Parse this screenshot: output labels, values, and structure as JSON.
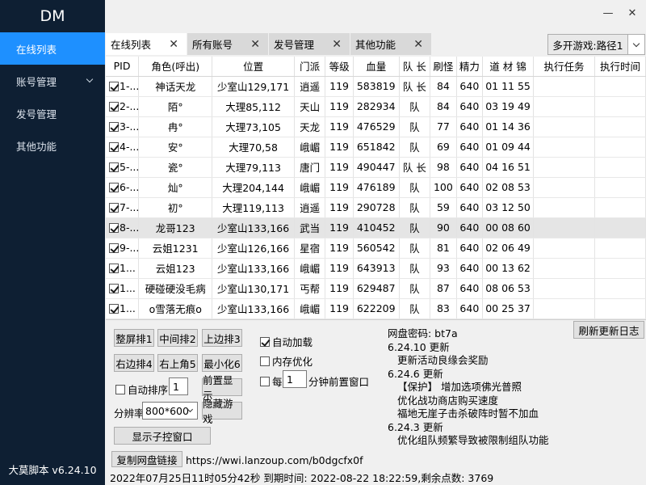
{
  "sidebar": {
    "title": "DM",
    "items": [
      {
        "label": "在线列表"
      },
      {
        "label": "账号管理"
      },
      {
        "label": "发号管理"
      },
      {
        "label": "其他功能"
      }
    ],
    "version": "大莫脚本 v6.24.10"
  },
  "window": {
    "minimize": "—",
    "close": "✕"
  },
  "tabs": [
    {
      "label": "在线列表"
    },
    {
      "label": "所有账号"
    },
    {
      "label": "发号管理"
    },
    {
      "label": "其他功能"
    }
  ],
  "route_button": "多开游戏:路径1",
  "table": {
    "headers": [
      "PID",
      "角色(呼出)",
      "位置",
      "门派",
      "等级",
      "血量",
      "队 长",
      "刷怪",
      "精力",
      "道 材 锦",
      "执行任务",
      "执行时间"
    ],
    "rows": [
      {
        "pid": "1-...",
        "role": "神话天龙",
        "pos": "少室山129,171",
        "sect": "逍遥",
        "lvl": "119",
        "hp": "583819",
        "team": "队 长",
        "kill": "84",
        "energy": "640",
        "items": "01 11 55",
        "task": "",
        "time": ""
      },
      {
        "pid": "2-...",
        "role": "陌°",
        "pos": "大理85,112",
        "sect": "天山",
        "lvl": "119",
        "hp": "282934",
        "team": "队",
        "kill": "84",
        "energy": "640",
        "items": "03 19 49",
        "task": "",
        "time": ""
      },
      {
        "pid": "3-...",
        "role": "冉°",
        "pos": "大理73,105",
        "sect": "天龙",
        "lvl": "119",
        "hp": "476529",
        "team": "队",
        "kill": "77",
        "energy": "640",
        "items": "01 14 36",
        "task": "",
        "time": ""
      },
      {
        "pid": "4-...",
        "role": "安°",
        "pos": "大理70,58",
        "sect": "峨嵋",
        "lvl": "119",
        "hp": "651842",
        "team": "队",
        "kill": "69",
        "energy": "640",
        "items": "01 09 44",
        "task": "",
        "time": ""
      },
      {
        "pid": "5-...",
        "role": "瓷°",
        "pos": "大理79,113",
        "sect": "唐门",
        "lvl": "119",
        "hp": "490447",
        "team": "队 长",
        "kill": "98",
        "energy": "640",
        "items": "04 16 51",
        "task": "",
        "time": ""
      },
      {
        "pid": "6-...",
        "role": "灿°",
        "pos": "大理204,144",
        "sect": "峨嵋",
        "lvl": "119",
        "hp": "476189",
        "team": "队",
        "kill": "100",
        "energy": "640",
        "items": "02 08 53",
        "task": "",
        "time": ""
      },
      {
        "pid": "7-...",
        "role": "初°",
        "pos": "大理119,113",
        "sect": "逍遥",
        "lvl": "119",
        "hp": "290728",
        "team": "队",
        "kill": "59",
        "energy": "640",
        "items": "03 12 50",
        "task": "",
        "time": ""
      },
      {
        "pid": "8-...",
        "role": "龙哥123",
        "pos": "少室山133,166",
        "sect": "武当",
        "lvl": "119",
        "hp": "410452",
        "team": "队",
        "kill": "90",
        "energy": "640",
        "items": "00 08 60",
        "task": "",
        "time": ""
      },
      {
        "pid": "9-...",
        "role": "云姐1231",
        "pos": "少室山126,166",
        "sect": "星宿",
        "lvl": "119",
        "hp": "560542",
        "team": "队",
        "kill": "81",
        "energy": "640",
        "items": "02 06 49",
        "task": "",
        "time": ""
      },
      {
        "pid": "1...",
        "role": "云姐123",
        "pos": "少室山133,166",
        "sect": "峨嵋",
        "lvl": "119",
        "hp": "643913",
        "team": "队",
        "kill": "93",
        "energy": "640",
        "items": "00 13 62",
        "task": "",
        "time": ""
      },
      {
        "pid": "1...",
        "role": "硬碰硬没毛病",
        "pos": "少室山130,171",
        "sect": "丐帮",
        "lvl": "119",
        "hp": "629487",
        "team": "队",
        "kill": "87",
        "energy": "640",
        "items": "08 06 53",
        "task": "",
        "time": ""
      },
      {
        "pid": "1...",
        "role": "o雪落无痕o",
        "pos": "少室山133,166",
        "sect": "峨嵋",
        "lvl": "119",
        "hp": "622209",
        "team": "队",
        "kill": "83",
        "energy": "640",
        "items": "00 25 37",
        "task": "",
        "time": ""
      }
    ]
  },
  "controls": {
    "fullscreen": "整屏排1",
    "middle": "中间排2",
    "top": "上边排3",
    "right": "右边排4",
    "topright": "右上角5",
    "minimize": "最小化6",
    "auto_sort": "自动排序",
    "auto_sort_value": "1",
    "front_show": "前置显示",
    "resolution_label": "分辨率",
    "resolution_value": "800*600",
    "hide_game": "隐藏游戏",
    "show_child": "显示子控窗口",
    "auto_load": "自动加载",
    "mem_opt": "内存优化",
    "every": "每",
    "every_value": "1",
    "every_suffix": "分钟前置窗口",
    "refresh_log": "刷新更新日志",
    "copy_link": "复制网盘链接"
  },
  "log": [
    {
      "text": "网盘密码:  bt7a",
      "indent": false
    },
    {
      "text": "6.24.10 更新",
      "indent": false
    },
    {
      "text": "更新活动良缘会奖励",
      "indent": true
    },
    {
      "text": "6.24.6 更新",
      "indent": false
    },
    {
      "text": "【保护】 增加选项佛光普照",
      "indent": true
    },
    {
      "text": "优化战功商店购买速度",
      "indent": true
    },
    {
      "text": "福地无崖子击杀破阵时暂不加血",
      "indent": true
    },
    {
      "text": "6.24.3 更新",
      "indent": false
    },
    {
      "text": "优化组队频繁导致被限制组队功能",
      "indent": true
    }
  ],
  "net_link": "https://wwi.lanzoup.com/b0dgcfx0f",
  "footer": "2022年07月25日11时05分42秒  到期时间:  2022-08-22 18:22:59,剩余点数:  3769"
}
